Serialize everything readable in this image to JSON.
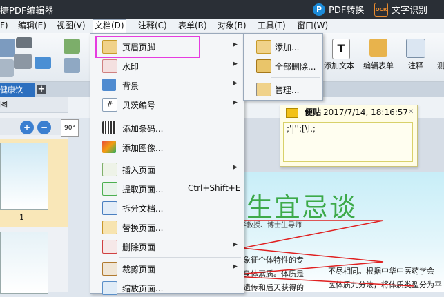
{
  "app": {
    "title": "捷PDF编辑器",
    "pdf_convert": "PDF转换",
    "ocr_logo": "OCR",
    "ocr": "文字识别",
    "pdf_logo": "P"
  },
  "menubar": [
    "F)",
    "编辑(E)",
    "视图(V)",
    "文档(D)",
    "注释(C)",
    "表单(R)",
    "对象(B)",
    "工具(T)",
    "窗口(W)"
  ],
  "toolbar": {
    "add_text": "添加文本",
    "edit_form": "编辑表单",
    "annotate": "注释",
    "cut_label": "测"
  },
  "tab": {
    "doc_name": "健康饮",
    "add": "+"
  },
  "panel": {
    "title": "图",
    "page_number": "1",
    "zoom": "90°"
  },
  "doc_menu": {
    "items": [
      {
        "label": "页眉页脚",
        "arrow": "▶"
      },
      {
        "label": "水印",
        "arrow": "▶"
      },
      {
        "label": "背景",
        "arrow": "▶"
      },
      {
        "label": "贝茨编号",
        "arrow": "▶"
      },
      {
        "label": "添加条码..."
      },
      {
        "label": "添加图像..."
      },
      {
        "label": "插入页面",
        "arrow": "▶"
      },
      {
        "label": "提取页面...",
        "shortcut": "Ctrl+Shift+E"
      },
      {
        "label": "拆分文档..."
      },
      {
        "label": "替换页面..."
      },
      {
        "label": "删除页面",
        "arrow": "▶"
      },
      {
        "label": "裁剪页面",
        "arrow": "▶"
      },
      {
        "label": "缩放页面..."
      }
    ]
  },
  "submenu": {
    "items": [
      {
        "label": "添加..."
      },
      {
        "label": "全部删除..."
      },
      {
        "label": "管理..."
      }
    ]
  },
  "sticky": {
    "title": "便贴",
    "timestamp": "2017/7/14, 18:16:57",
    "content": ";'|'';[\\l.;",
    "close": "✕"
  },
  "document": {
    "heading": "生宜忌谈",
    "subtitle": "学教授、博士生导师",
    "lines": [
      "象征个体特性的专",
      "身体素质。体质是",
      "遗传和后天获得的"
    ],
    "right_lines": [
      "不尽相同。根据中华中医药学会",
      "医体质九分法，将体质类型分为平"
    ]
  },
  "colors": {
    "accent": "#2c6fbf",
    "highlight_box": "#e63ce0",
    "heading": "#3daa4a",
    "titlebar": "#2a2f36"
  }
}
